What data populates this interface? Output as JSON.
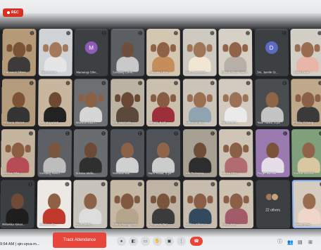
{
  "recording": {
    "label": "REC"
  },
  "participants": [
    {
      "name": "Hamsanti Sihom...",
      "kind": "video",
      "bg": "#b59a78",
      "skin": "#7a5236",
      "shirt": "#3d3a3a",
      "hands": true
    },
    {
      "name": "Yanti Mariati",
      "kind": "video",
      "bg": "#cfd3d6",
      "skin": "#a4785a",
      "shirt": "#e5e5e5",
      "hands": true
    },
    {
      "name": "Marsenyp Sihn...",
      "kind": "avatar",
      "initial": "M",
      "color": "#8e5bb5"
    },
    {
      "name": "Sondang Lumb...",
      "kind": "video",
      "bg": "#5b5f63",
      "skin": "#6e4e3c",
      "shirt": "#c9c9c9",
      "hands": false
    },
    {
      "name": "Theresia Lubis...",
      "kind": "video",
      "bg": "#d4c7b2",
      "skin": "#8d6245",
      "shirt": "#c58c5c",
      "hands": true
    },
    {
      "name": "Rina Sinambela...",
      "kind": "video",
      "bg": "#cfcac1",
      "skin": "#a07658",
      "shirt": "#f0e6d3",
      "hands": true
    },
    {
      "name": "Ronare Sitanggang...",
      "kind": "video",
      "bg": "#d6d0c6",
      "skin": "#8f6448",
      "shirt": "#b7b0a8",
      "hands": true
    },
    {
      "name": "Drs. Jamilin Si...",
      "kind": "avatar",
      "initial": "D",
      "color": "#5c6bc0"
    },
    {
      "name": "Juwita Dewi...",
      "kind": "video",
      "bg": "#d3cfc7",
      "skin": "#9a6d50",
      "shirt": "#e8b6a8",
      "hands": true
    },
    {
      "name": "Mariana Sitorus",
      "kind": "video",
      "bg": "#b49b7c",
      "skin": "#7d5337",
      "shirt": "#343434",
      "hands": false
    },
    {
      "name": "Nila Mayuniati...",
      "kind": "video",
      "bg": "#c8b79e",
      "skin": "#6f4a33",
      "shirt": "#222",
      "hands": false
    },
    {
      "name": "Marsiun Situm...",
      "kind": "video",
      "bg": "#6d7073",
      "skin": "#8a6046",
      "shirt": "#d6d6d6",
      "hands": true
    },
    {
      "name": "Dra. Haymaria...",
      "kind": "video",
      "bg": "#bdb3a4",
      "skin": "#6b4835",
      "shirt": "#5b4a3c",
      "hands": true
    },
    {
      "name": "Nuraini, S.pd",
      "kind": "video",
      "bg": "#cbbfae",
      "skin": "#875c42",
      "shirt": "#9c2f3a",
      "hands": true
    },
    {
      "name": "Nurlisa Ambri...",
      "kind": "video",
      "bg": "#ccc4b8",
      "skin": "#9a6f52",
      "shirt": "#8fa3b0",
      "hands": true
    },
    {
      "name": "Nurhayati S...",
      "kind": "video",
      "bg": "#d2cabe",
      "skin": "#9b7256",
      "shirt": "#eaeaea",
      "hands": true
    },
    {
      "name": "Nani Yunita, S.pd",
      "kind": "video",
      "bg": "#4a4d50",
      "skin": "#8f6548",
      "shirt": "#c4c4c4",
      "hands": false
    },
    {
      "name": "Prisilia Girsang",
      "kind": "video",
      "bg": "#bfa98a",
      "skin": "#8a6046",
      "shirt": "#3a3a3a",
      "hands": true
    },
    {
      "name": "Marlina Siha...",
      "kind": "video",
      "bg": "#c4b49e",
      "skin": "#8b5e43",
      "shirt": "#b84c54",
      "hands": true
    },
    {
      "name": "Sondang Nover...",
      "kind": "video",
      "bg": "#5d6064",
      "skin": "#7b563f",
      "shirt": "#bdbdbd",
      "hands": false
    },
    {
      "name": "Susima Mella...",
      "kind": "video",
      "bg": "#6a6d70",
      "skin": "#6d4a36",
      "shirt": "#2f2f2f",
      "hands": false
    },
    {
      "name": "Hotmauli Mar...",
      "kind": "video",
      "bg": "#50535a",
      "skin": "#8a6248",
      "shirt": "#d0d0d0",
      "hands": false
    },
    {
      "name": "Nani Yunita, S.pd",
      "kind": "video",
      "bg": "#4f5256",
      "skin": "#8e6549",
      "shirt": "#cccccc",
      "hands": false
    },
    {
      "name": "Jimi Rumapea...",
      "kind": "video",
      "bg": "#a9a094",
      "skin": "#6f4c37",
      "shirt": "#2d2d2d",
      "hands": false
    },
    {
      "name": "Marisa Siha...",
      "kind": "video",
      "bg": "#cfc5b6",
      "skin": "#8a6046",
      "shirt": "#b36b72",
      "hands": true
    },
    {
      "name": "Roger Mansur...",
      "kind": "video",
      "bg": "#9a7bb0",
      "skin": "#7a5339",
      "shirt": "#e5dde8",
      "hands": false
    },
    {
      "name": "Hanna Situmor...",
      "kind": "video",
      "bg": "#7fa07a",
      "skin": "#8f6448",
      "shirt": "#d8c7a1",
      "hands": false
    },
    {
      "name": "Rebekka Simar...",
      "kind": "video",
      "bg": "#3c3f42",
      "skin": "#6e4b37",
      "shirt": "#1e1e1e",
      "hands": false
    },
    {
      "name": "Natalia Luba...",
      "kind": "video",
      "bg": "#ece9e4",
      "skin": "#8e6146",
      "shirt": "#c0392b",
      "hands": false
    },
    {
      "name": "Nurlis Mella...",
      "kind": "video",
      "bg": "#c9c4bb",
      "skin": "#8b6247",
      "shirt": "#ddd",
      "hands": false
    },
    {
      "name": "Tiarma Nainggolan",
      "kind": "video",
      "bg": "#c5b8a5",
      "skin": "#7f5a41",
      "shirt": "#b5a58d",
      "hands": true
    },
    {
      "name": "Lismawati Tam...",
      "kind": "video",
      "bg": "#bfb4a4",
      "skin": "#7a553d",
      "shirt": "#3b3b3b",
      "hands": true
    },
    {
      "name": "Marlina Silitonga",
      "kind": "video",
      "bg": "#c7bcae",
      "skin": "#8a5e44",
      "shirt": "#324a5f",
      "hands": true
    },
    {
      "name": "Frima Jum...",
      "kind": "video",
      "bg": "#cec2b2",
      "skin": "#8b6047",
      "shirt": "#a35b6a",
      "hands": true
    },
    {
      "name": "22 others",
      "kind": "others"
    },
    {
      "name": "Juwita Dewi",
      "kind": "video",
      "bg": "#d5cbbf",
      "skin": "#9a6c4f",
      "shirt": "#efd6c8",
      "hands": false,
      "active": true
    }
  ],
  "bottom_bar": {
    "time": "9:54 AM",
    "meeting_code": "qin-vpca-m...",
    "track_attendance_label": "Track Attendance"
  }
}
